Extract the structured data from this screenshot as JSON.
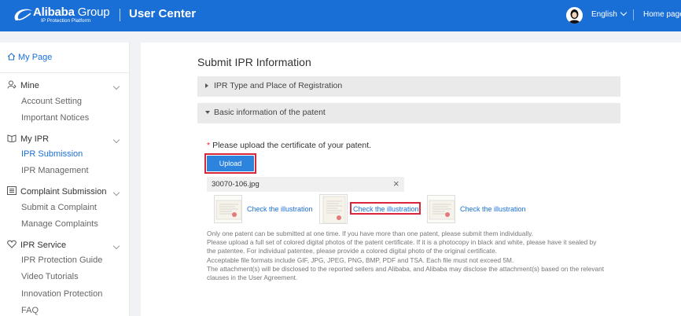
{
  "header": {
    "logo_main": "Alibaba",
    "logo_group": "Group",
    "logo_sub": "IP Protection Platform",
    "title": "User Center",
    "language": "English",
    "home": "Home page"
  },
  "sidebar": {
    "my_page": "My Page",
    "groups": [
      {
        "label": "Mine",
        "icon": "user-icon",
        "items": [
          "Account Setting",
          "Important Notices"
        ]
      },
      {
        "label": "My IPR",
        "icon": "book-icon",
        "items": [
          "IPR Submission",
          "IPR Management"
        ],
        "active": "IPR Submission"
      },
      {
        "label": "Complaint Submission",
        "icon": "list-icon",
        "items": [
          "Submit a Complaint",
          "Manage Complaints"
        ]
      },
      {
        "label": "IPR Service",
        "icon": "heart-icon",
        "items": [
          "IPR Protection Guide",
          "Video Tutorials",
          "Innovation Protection",
          "FAQ"
        ]
      }
    ]
  },
  "main": {
    "title": "Submit IPR Information",
    "accordion": [
      {
        "label": "IPR Type and Place of Registration",
        "expanded": false
      },
      {
        "label": "Basic information of the patent",
        "expanded": true
      }
    ],
    "required_star": "*",
    "upload_prompt": "Please upload the certificate of your patent.",
    "upload_label": "Upload",
    "file_name": "30070-106.jpg",
    "remove_label": "×",
    "illustrations": [
      "Check the illustration",
      "Check the illustration",
      "Check the illustration"
    ],
    "notes": [
      "Only one patent can be submitted at one time. If you have more than one patent, please submit them individually.",
      "Please upload a full set of colored digital photos of the patent certificate. If it is a photocopy in black and white, please have it sealed by",
      "the patentee. For individual patentee, please provide a colored digital photo of the original certificate.",
      "Acceptable file formats include GIF, JPG, JPEG, PNG, BMP, PDF and TSA. Each file must not exceed 5M.",
      "The attachment(s) will be disclosed to the reported sellers and Alibaba, and Alibaba may disclose the attachment(s) based on the relevant",
      "clauses in the User Agreement."
    ]
  },
  "colors": {
    "brand_blue": "#1a6fd6",
    "button_blue": "#2c84de",
    "highlight_red": "#d9263a"
  }
}
